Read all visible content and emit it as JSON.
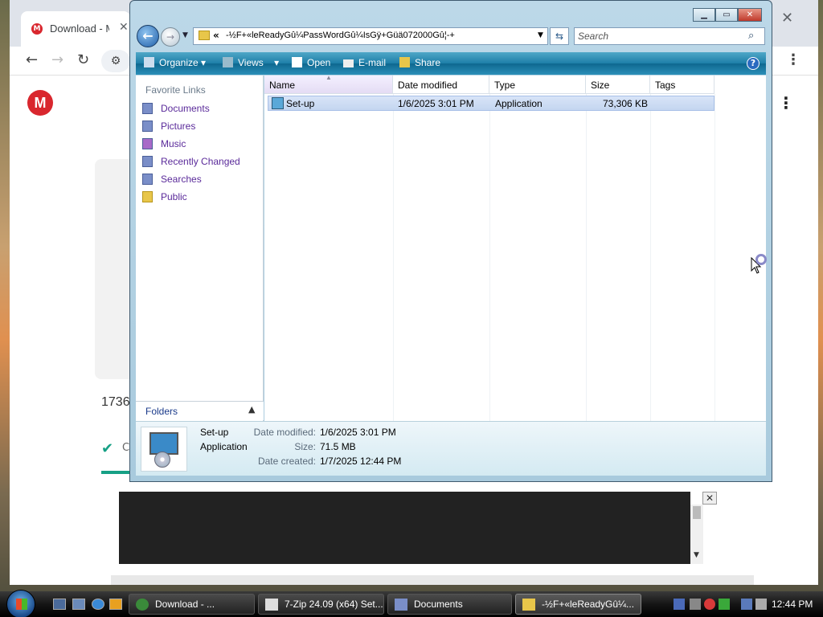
{
  "browser": {
    "tab_title": "Download - M",
    "page_count_text": "1736",
    "page_status_text": "C"
  },
  "explorer": {
    "address_chevron": "«",
    "address_path": "-½F+«leReadyGû¼PassWordGû¼IsGÿ+Güä072000Gû¦-+",
    "search_placeholder": "Search",
    "command_bar": {
      "organize": "Organize",
      "views": "Views",
      "open": "Open",
      "email": "E-mail",
      "share": "Share"
    },
    "nav_pane": {
      "header": "Favorite Links",
      "links": [
        "Documents",
        "Pictures",
        "Music",
        "Recently Changed",
        "Searches",
        "Public"
      ],
      "folders_label": "Folders"
    },
    "columns": [
      "Name",
      "Date modified",
      "Type",
      "Size",
      "Tags"
    ],
    "rows": [
      {
        "name": "Set-up",
        "date_modified": "1/6/2025 3:01 PM",
        "type": "Application",
        "size": "73,306 KB",
        "tags": ""
      }
    ],
    "details": {
      "name": "Set-up",
      "type": "Application",
      "date_modified_label": "Date modified:",
      "date_modified": "1/6/2025 3:01 PM",
      "size_label": "Size:",
      "size": "71.5 MB",
      "date_created_label": "Date created:",
      "date_created": "1/7/2025 12:44 PM"
    }
  },
  "taskbar": {
    "tasks": [
      "Download - ...",
      "7-Zip 24.09 (x64) Set...",
      "Documents",
      "-½F+«leReadyGû¼..."
    ],
    "clock": "12:44 PM"
  },
  "colors": {
    "accent_bar": "#1d7ea8",
    "selection": "#c4d6f0",
    "link_purple": "#5a2a9a",
    "mega_red": "#d9272e"
  }
}
